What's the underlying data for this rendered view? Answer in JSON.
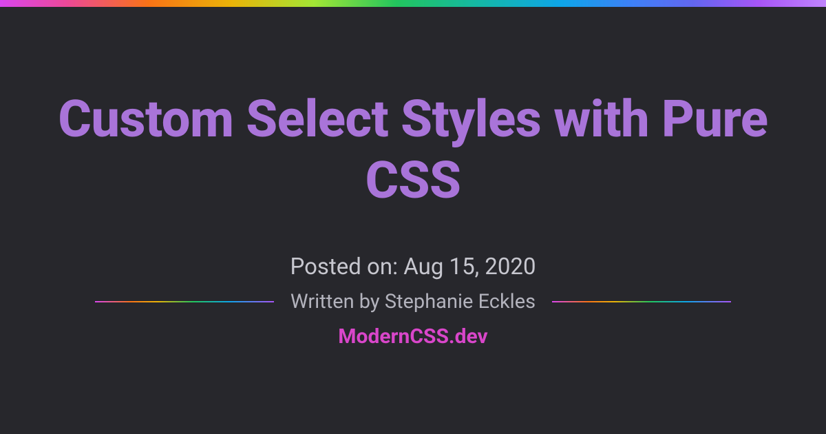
{
  "title": "Custom Select Styles with Pure CSS",
  "posted_on": "Posted on: Aug 15, 2020",
  "byline": "Written by Stephanie Eckles",
  "site_name": "ModernCSS.dev"
}
